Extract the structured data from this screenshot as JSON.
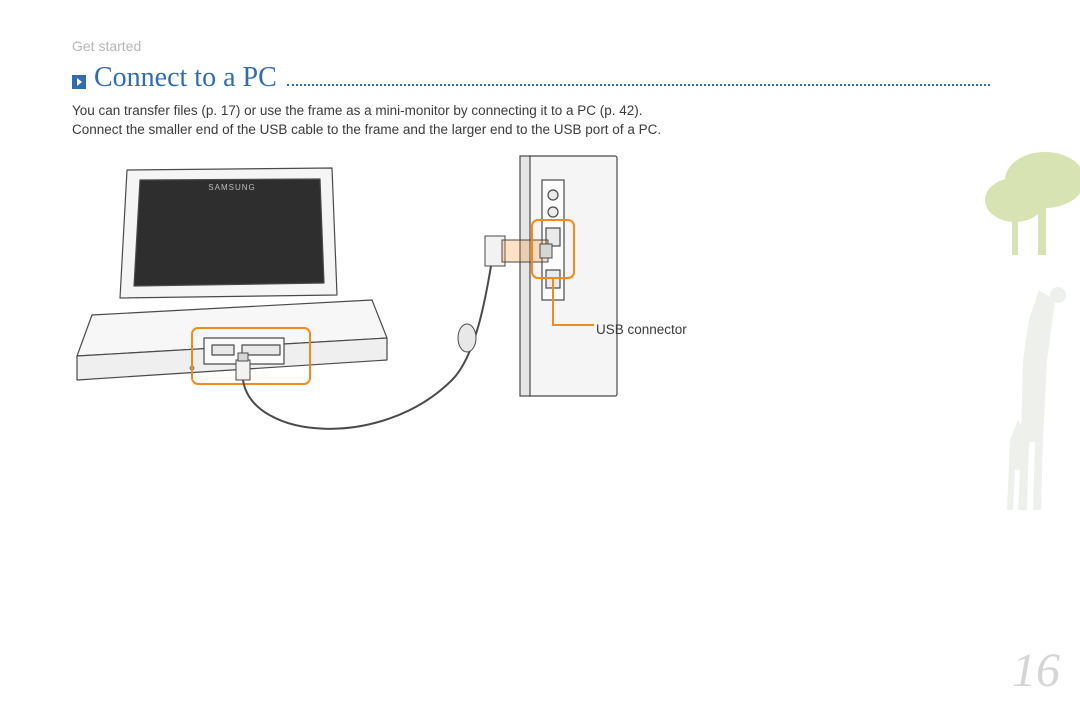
{
  "breadcrumb": "Get started",
  "heading": "Connect to a PC",
  "body_line1": "You can transfer files (p. 17) or use the frame as a mini-monitor by connecting it to a PC (p. 42).",
  "body_line2": "Connect the smaller end of the USB cable to the frame and the larger end to the USB port of a PC.",
  "callout_label": "USB connector",
  "device_brand": "SAMSUNG",
  "page_number": "16",
  "colors": {
    "accent_blue": "#2f6db0",
    "highlight_orange": "#f28a1c",
    "muted_gray": "#b7b7b7"
  }
}
